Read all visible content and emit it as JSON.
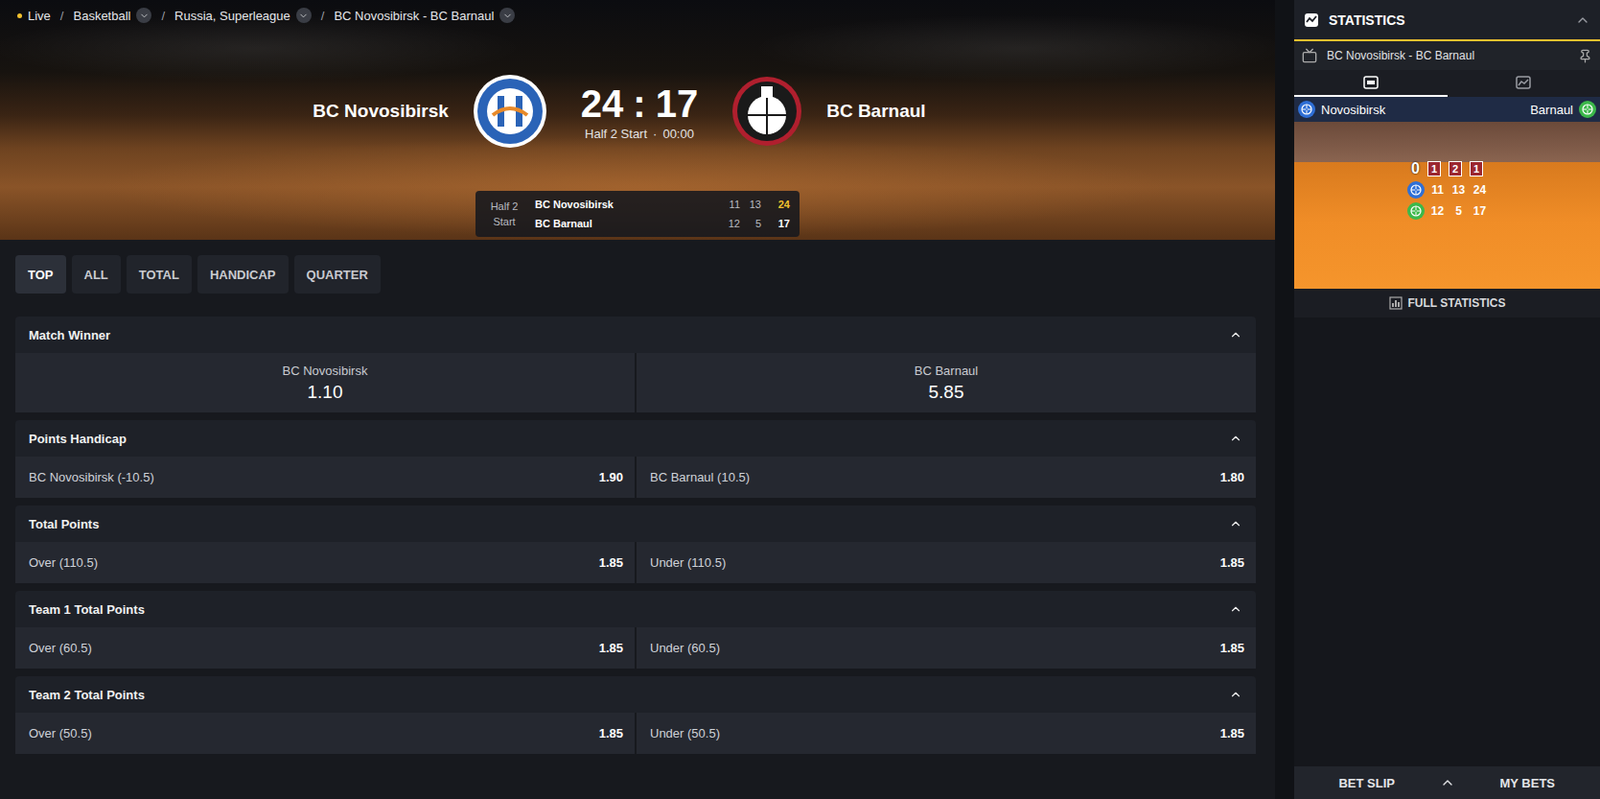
{
  "breadcrumb": {
    "live": "Live",
    "separator": "/",
    "items": [
      {
        "label": "Basketball",
        "dropdown": true
      },
      {
        "label": "Russia, Superleague",
        "dropdown": true
      },
      {
        "label": "BC Novosibirsk - BC Barnaul",
        "dropdown": true
      }
    ]
  },
  "match": {
    "home": "BC Novosibirsk",
    "away": "BC Barnaul",
    "score_home": "24",
    "score_sep": ":",
    "score_away": "17",
    "period": "Half 2 Start",
    "dot": "·",
    "clock": "00:00"
  },
  "scoreboard": {
    "label": [
      "Half 2",
      "Start"
    ],
    "rows": [
      {
        "team": "BC Novosibirsk",
        "periods": [
          "11",
          "13"
        ],
        "total": "24",
        "highlight": true
      },
      {
        "team": "BC Barnaul",
        "periods": [
          "12",
          "5"
        ],
        "total": "17",
        "highlight": false
      }
    ]
  },
  "tabs": [
    {
      "label": "TOP",
      "selected": true
    },
    {
      "label": "ALL",
      "selected": false
    },
    {
      "label": "TOTAL",
      "selected": false
    },
    {
      "label": "HANDICAP",
      "selected": false
    },
    {
      "label": "QUARTER",
      "selected": false
    }
  ],
  "markets": [
    {
      "title": "Match Winner",
      "kind": "winner",
      "expanded": true,
      "outcomes": [
        {
          "label": "BC Novosibirsk",
          "odds": "1.10"
        },
        {
          "label": "BC Barnaul",
          "odds": "5.85"
        }
      ]
    },
    {
      "title": "Points Handicap",
      "kind": "line",
      "expanded": true,
      "outcomes": [
        {
          "label": "BC Novosibirsk (-10.5)",
          "odds": "1.90"
        },
        {
          "label": "BC Barnaul (10.5)",
          "odds": "1.80"
        }
      ]
    },
    {
      "title": "Total Points",
      "kind": "line",
      "expanded": true,
      "outcomes": [
        {
          "label": "Over (110.5)",
          "odds": "1.85"
        },
        {
          "label": "Under (110.5)",
          "odds": "1.85"
        }
      ]
    },
    {
      "title": "Team 1 Total Points",
      "kind": "line",
      "expanded": true,
      "outcomes": [
        {
          "label": "Over (60.5)",
          "odds": "1.85"
        },
        {
          "label": "Under (60.5)",
          "odds": "1.85"
        }
      ]
    },
    {
      "title": "Team 2 Total Points",
      "kind": "line",
      "expanded": true,
      "outcomes": [
        {
          "label": "Over (50.5)",
          "odds": "1.85"
        },
        {
          "label": "Under (50.5)",
          "odds": "1.85"
        }
      ]
    }
  ],
  "sidebar": {
    "title": "STATISTICS",
    "expanded": true,
    "match": "BC Novosibirsk - BC Barnaul",
    "tabs": [
      {
        "kind": "live",
        "selected": true
      },
      {
        "kind": "chart",
        "selected": false
      }
    ],
    "teams": [
      {
        "name": "Novosibirsk",
        "color": "#2f6fd6"
      },
      {
        "name": "Barnaul",
        "color": "#3cb84a"
      }
    ],
    "court": {
      "big": "0",
      "periods": [
        "1",
        "2",
        "1"
      ],
      "rows": [
        [
          "11",
          "13",
          "24"
        ],
        [
          "12",
          "5",
          "17"
        ]
      ]
    },
    "full_stats": "FULL STATISTICS"
  },
  "footer": {
    "bet_slip": "BET SLIP",
    "my_bets": "MY BETS",
    "expanded": false
  }
}
